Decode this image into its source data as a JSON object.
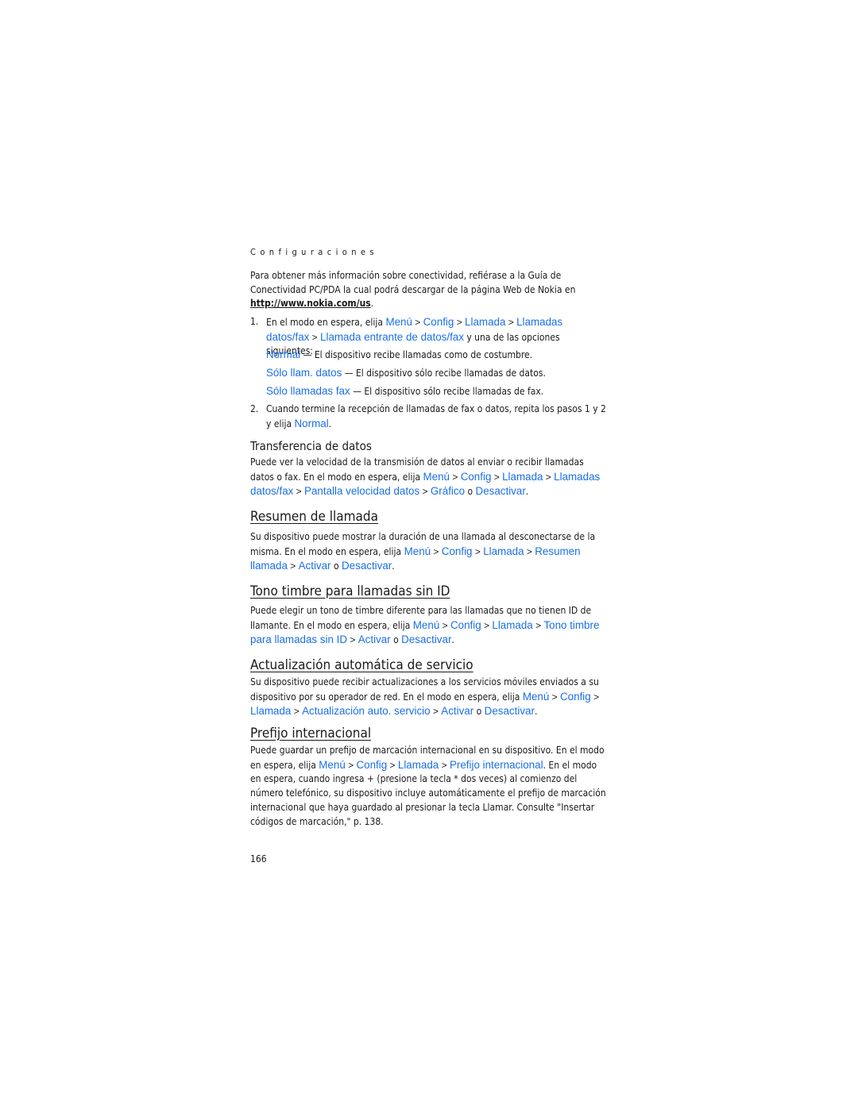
{
  "running_head": "Configuraciones",
  "intro": {
    "text": "Para obtener más información sobre conectividad, refiérase a la Guía de Conectividad PC/PDA la cual podrá descargar de la página Web de Nokia en ",
    "link": "http://www.nokia.com/us",
    "end": "."
  },
  "step1": {
    "num": "1.",
    "pre": "En el modo en espera, elija ",
    "path": [
      "Menú",
      "Config",
      "Llamada",
      "Llamadas datos/fax",
      "Llamada entrante de datos/fax"
    ],
    "post": " y una de las opciones siguientes:",
    "options": [
      {
        "label": "Normal",
        "desc": "El dispositivo recibe llamadas como de costumbre."
      },
      {
        "label": "Sólo llam. datos",
        "desc": "El dispositivo sólo recibe llamadas de datos."
      },
      {
        "label": "Sólo llamadas fax",
        "desc": "El dispositivo sólo recibe llamadas de fax."
      }
    ]
  },
  "step2": {
    "num": "2.",
    "pre": "Cuando termine la recepción de llamadas de fax o datos, repita los pasos 1 y 2 y elija ",
    "option": "Normal",
    "end": "."
  },
  "sections": {
    "transfer": {
      "title": "Transferencia de datos",
      "pre": "Puede ver la velocidad de la transmisión de datos al enviar o recibir llamadas datos o fax. En el modo en espera, elija ",
      "path": [
        "Menú",
        "Config",
        "Llamada",
        "Llamadas datos/fax",
        "Pantalla velocidad datos"
      ],
      "opt1": "Gráfico",
      "or": " o ",
      "opt2": "Desactivar",
      "end": "."
    },
    "summary": {
      "title": "Resumen de llamada",
      "pre": "Su dispositivo puede mostrar la duración de una llamada al desconectarse de la misma. En el modo en espera, elija ",
      "path": [
        "Menú",
        "Config",
        "Llamada",
        "Resumen llamada"
      ],
      "opt1": "Activar",
      "or": " o ",
      "opt2": "Desactivar",
      "end": "."
    },
    "ringtone": {
      "title": "Tono timbre para llamadas sin ID",
      "pre": "Puede elegir un tono de timbre diferente para las llamadas que no tienen ID de llamante. En el modo en espera, elija ",
      "path": [
        "Menú",
        "Config",
        "Llamada",
        "Tono timbre para llamadas sin ID"
      ],
      "opt1": "Activar",
      "or": " o ",
      "opt2": "Desactivar",
      "end": "."
    },
    "update": {
      "title": "Actualización automática de servicio",
      "pre": "Su dispositivo puede recibir actualizaciones a los servicios móviles enviados a su dispositivo por su operador de red. En el modo en espera, elija ",
      "path": [
        "Menú",
        "Config",
        "Llamada",
        "Actualización auto. servicio"
      ],
      "opt1": "Activar",
      "or": " o ",
      "opt2": "Desactivar",
      "end": "."
    },
    "prefix": {
      "title": "Prefijo internacional",
      "pre": "Puede guardar un prefijo de marcación internacional en su dispositivo. En el modo en espera, elija ",
      "path": [
        "Menú",
        "Config",
        "Llamada",
        "Prefijo internacional"
      ],
      "post": ". En el modo en espera, cuando ingresa + (presione la tecla * dos veces) al comienzo del número telefónico, su dispositivo incluye automáticamente el prefijo de marcación internacional que haya guardado al presionar la tecla Llamar. Consulte \"Insertar códigos de marcación,\" p. 138."
    }
  },
  "page_number": "166",
  "colors": {
    "ui_text": "#1a6fe6",
    "body_text": "#1a1a1a"
  }
}
